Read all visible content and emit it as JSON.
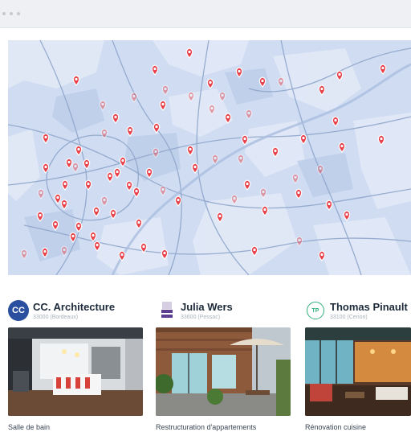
{
  "window": {
    "dots": 3
  },
  "map": {
    "background_color": "#cfdcf2",
    "pin_color": "#e8414a",
    "road_color": "#8fa6cb",
    "pin_count": 82
  },
  "contractors": [
    {
      "name": "CC. Architecture",
      "location": "33000 (Bordeaux)",
      "logo_text": "CC",
      "logo_color": "#2a4f9e",
      "project": "Salle de bain"
    },
    {
      "name": "Julia Wers",
      "location": "33600 (Pessac)",
      "logo_text": "Julia Wers",
      "logo_color": "#5d3f92",
      "project": "Restructuration d'appartements"
    },
    {
      "name": "Thomas Pinault",
      "location": "33100 (Cenon)",
      "logo_text": "TP",
      "logo_color": "#2eae7a",
      "project": "Rénovation cuisine"
    }
  ]
}
